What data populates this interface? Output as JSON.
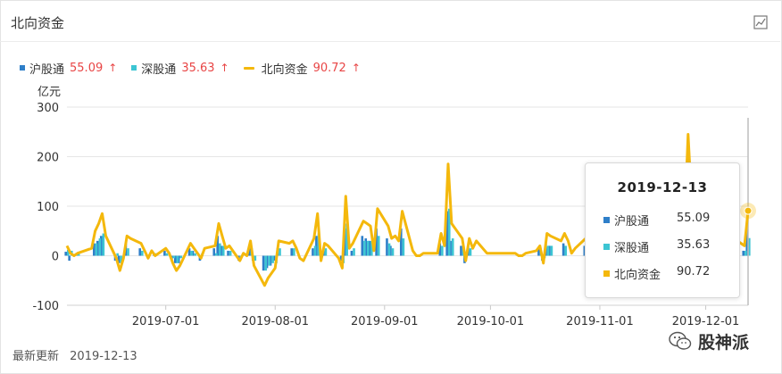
{
  "panel": {
    "title": "北向资金"
  },
  "legend": [
    {
      "name": "沪股通",
      "value": "55.09",
      "arrow": "↑",
      "color": "#2e7fc9"
    },
    {
      "name": "深股通",
      "value": "35.63",
      "arrow": "↑",
      "color": "#3cc5d3"
    },
    {
      "name": "北向资金",
      "value": "90.72",
      "arrow": "↑",
      "color": "#f4b80c"
    }
  ],
  "tooltip": {
    "date": "2019-12-13",
    "rows": [
      {
        "name": "沪股通",
        "value": "55.09"
      },
      {
        "name": "深股通",
        "value": "35.63"
      },
      {
        "name": "北向资金",
        "value": "90.72"
      }
    ]
  },
  "footer": {
    "label": "最新更新",
    "date": "2019-12-13"
  },
  "watermark": {
    "text": "股神派"
  },
  "colors": {
    "sh": "#2e7fc9",
    "sz": "#3cc5d3",
    "total": "#f4b80c",
    "grid": "#e6e6e6"
  },
  "chart_data": {
    "type": "bar+line",
    "ylabel": "亿元",
    "ylim": [
      -100,
      300
    ],
    "yticks": [
      -100,
      0,
      100,
      200,
      300
    ],
    "xticks": [
      "2019-07-01",
      "2019-08-01",
      "2019-09-01",
      "2019-10-01",
      "2019-11-01",
      "2019-12-01"
    ],
    "x_start": "2019-06-03",
    "x_end": "2019-12-13",
    "grid": "horizontal",
    "series": [
      {
        "name": "北向资金",
        "type": "line",
        "values": [
          [
            "2019-06-03",
            20
          ],
          [
            "2019-06-04",
            5
          ],
          [
            "2019-06-05",
            0
          ],
          [
            "2019-06-06",
            5
          ],
          [
            "2019-06-10",
            15
          ],
          [
            "2019-06-11",
            50
          ],
          [
            "2019-06-12",
            65
          ],
          [
            "2019-06-13",
            85
          ],
          [
            "2019-06-14",
            40
          ],
          [
            "2019-06-17",
            -5
          ],
          [
            "2019-06-18",
            -30
          ],
          [
            "2019-06-19",
            -5
          ],
          [
            "2019-06-20",
            40
          ],
          [
            "2019-06-21",
            35
          ],
          [
            "2019-06-24",
            25
          ],
          [
            "2019-06-25",
            10
          ],
          [
            "2019-06-26",
            -5
          ],
          [
            "2019-06-27",
            10
          ],
          [
            "2019-06-28",
            0
          ],
          [
            "2019-07-01",
            15
          ],
          [
            "2019-07-02",
            5
          ],
          [
            "2019-07-03",
            -15
          ],
          [
            "2019-07-04",
            -30
          ],
          [
            "2019-07-05",
            -20
          ],
          [
            "2019-07-08",
            25
          ],
          [
            "2019-07-09",
            15
          ],
          [
            "2019-07-10",
            5
          ],
          [
            "2019-07-11",
            -5
          ],
          [
            "2019-07-12",
            15
          ],
          [
            "2019-07-15",
            20
          ],
          [
            "2019-07-16",
            65
          ],
          [
            "2019-07-17",
            40
          ],
          [
            "2019-07-18",
            15
          ],
          [
            "2019-07-19",
            20
          ],
          [
            "2019-07-22",
            -10
          ],
          [
            "2019-07-23",
            5
          ],
          [
            "2019-07-24",
            0
          ],
          [
            "2019-07-25",
            30
          ],
          [
            "2019-07-26",
            -20
          ],
          [
            "2019-07-29",
            -60
          ],
          [
            "2019-07-30",
            -45
          ],
          [
            "2019-07-31",
            -35
          ],
          [
            "2019-08-01",
            -25
          ],
          [
            "2019-08-02",
            30
          ],
          [
            "2019-08-05",
            25
          ],
          [
            "2019-08-06",
            30
          ],
          [
            "2019-08-07",
            15
          ],
          [
            "2019-08-08",
            -5
          ],
          [
            "2019-08-09",
            -10
          ],
          [
            "2019-08-12",
            35
          ],
          [
            "2019-08-13",
            85
          ],
          [
            "2019-08-14",
            -10
          ],
          [
            "2019-08-15",
            25
          ],
          [
            "2019-08-16",
            20
          ],
          [
            "2019-08-19",
            -5
          ],
          [
            "2019-08-20",
            -25
          ],
          [
            "2019-08-21",
            120
          ],
          [
            "2019-08-22",
            15
          ],
          [
            "2019-08-23",
            25
          ],
          [
            "2019-08-26",
            70
          ],
          [
            "2019-08-27",
            65
          ],
          [
            "2019-08-28",
            60
          ],
          [
            "2019-08-29",
            10
          ],
          [
            "2019-08-30",
            95
          ],
          [
            "2019-09-02",
            60
          ],
          [
            "2019-09-03",
            35
          ],
          [
            "2019-09-04",
            40
          ],
          [
            "2019-09-05",
            30
          ],
          [
            "2019-09-06",
            90
          ],
          [
            "2019-09-09",
            10
          ],
          [
            "2019-09-10",
            0
          ],
          [
            "2019-09-11",
            0
          ],
          [
            "2019-09-12",
            5
          ],
          [
            "2019-09-16",
            5
          ],
          [
            "2019-09-17",
            45
          ],
          [
            "2019-09-18",
            20
          ],
          [
            "2019-09-19",
            185
          ],
          [
            "2019-09-20",
            65
          ],
          [
            "2019-09-23",
            35
          ],
          [
            "2019-09-24",
            -10
          ],
          [
            "2019-09-25",
            35
          ],
          [
            "2019-09-26",
            15
          ],
          [
            "2019-09-27",
            30
          ],
          [
            "2019-09-30",
            5
          ],
          [
            "2019-10-08",
            5
          ],
          [
            "2019-10-09",
            0
          ],
          [
            "2019-10-10",
            0
          ],
          [
            "2019-10-11",
            5
          ],
          [
            "2019-10-14",
            10
          ],
          [
            "2019-10-15",
            20
          ],
          [
            "2019-10-16",
            -15
          ],
          [
            "2019-10-17",
            45
          ],
          [
            "2019-10-18",
            40
          ],
          [
            "2019-10-21",
            30
          ],
          [
            "2019-10-22",
            45
          ],
          [
            "2019-10-23",
            30
          ],
          [
            "2019-10-24",
            5
          ],
          [
            "2019-10-25",
            15
          ],
          [
            "2019-10-28",
            35
          ],
          [
            "2019-10-29",
            5
          ],
          [
            "2019-10-30",
            -10
          ],
          [
            "2019-10-31",
            25
          ],
          [
            "2019-11-01",
            35
          ],
          [
            "2019-11-04",
            40
          ],
          [
            "2019-11-05",
            95
          ],
          [
            "2019-11-06",
            65
          ],
          [
            "2019-11-07",
            40
          ],
          [
            "2019-11-08",
            45
          ],
          [
            "2019-11-11",
            60
          ],
          [
            "2019-11-12",
            55
          ],
          [
            "2019-11-13",
            55
          ],
          [
            "2019-11-14",
            40
          ],
          [
            "2019-11-15",
            50
          ],
          [
            "2019-11-18",
            60
          ],
          [
            "2019-11-19",
            70
          ],
          [
            "2019-11-20",
            50
          ],
          [
            "2019-11-21",
            40
          ],
          [
            "2019-11-22",
            60
          ],
          [
            "2019-11-25",
            65
          ],
          [
            "2019-11-26",
            245
          ],
          [
            "2019-11-27",
            110
          ],
          [
            "2019-11-28",
            60
          ],
          [
            "2019-11-29",
            55
          ],
          [
            "2019-12-02",
            40
          ],
          [
            "2019-12-03",
            60
          ],
          [
            "2019-12-04",
            50
          ],
          [
            "2019-12-05",
            55
          ],
          [
            "2019-12-06",
            45
          ],
          [
            "2019-12-09",
            40
          ],
          [
            "2019-12-10",
            30
          ],
          [
            "2019-12-11",
            25
          ],
          [
            "2019-12-12",
            20
          ],
          [
            "2019-12-13",
            90.72
          ]
        ]
      },
      {
        "name": "沪股通",
        "type": "bar",
        "values": [
          [
            "2019-06-03",
            8
          ],
          [
            "2019-06-04",
            -10
          ],
          [
            "2019-06-06",
            5
          ],
          [
            "2019-06-11",
            25
          ],
          [
            "2019-06-12",
            30
          ],
          [
            "2019-06-13",
            40
          ],
          [
            "2019-06-17",
            -10
          ],
          [
            "2019-06-18",
            -15
          ],
          [
            "2019-06-20",
            25
          ],
          [
            "2019-06-24",
            15
          ],
          [
            "2019-06-28",
            5
          ],
          [
            "2019-07-01",
            10
          ],
          [
            "2019-07-03",
            -10
          ],
          [
            "2019-07-04",
            -15
          ],
          [
            "2019-07-05",
            -15
          ],
          [
            "2019-07-08",
            15
          ],
          [
            "2019-07-09",
            10
          ],
          [
            "2019-07-11",
            -10
          ],
          [
            "2019-07-15",
            15
          ],
          [
            "2019-07-16",
            40
          ],
          [
            "2019-07-17",
            20
          ],
          [
            "2019-07-19",
            10
          ],
          [
            "2019-07-22",
            -10
          ],
          [
            "2019-07-25",
            15
          ],
          [
            "2019-07-26",
            -10
          ],
          [
            "2019-07-29",
            -30
          ],
          [
            "2019-07-30",
            -25
          ],
          [
            "2019-07-31",
            -20
          ],
          [
            "2019-08-01",
            -10
          ],
          [
            "2019-08-02",
            15
          ],
          [
            "2019-08-06",
            15
          ],
          [
            "2019-08-12",
            15
          ],
          [
            "2019-08-13",
            40
          ],
          [
            "2019-08-15",
            10
          ],
          [
            "2019-08-20",
            -10
          ],
          [
            "2019-08-21",
            55
          ],
          [
            "2019-08-23",
            10
          ],
          [
            "2019-08-26",
            40
          ],
          [
            "2019-08-27",
            35
          ],
          [
            "2019-08-28",
            30
          ],
          [
            "2019-08-30",
            55
          ],
          [
            "2019-09-02",
            35
          ],
          [
            "2019-09-03",
            20
          ],
          [
            "2019-09-06",
            55
          ],
          [
            "2019-09-17",
            25
          ],
          [
            "2019-09-19",
            90
          ],
          [
            "2019-09-20",
            30
          ],
          [
            "2019-09-23",
            20
          ],
          [
            "2019-09-24",
            -15
          ],
          [
            "2019-09-25",
            20
          ],
          [
            "2019-10-15",
            15
          ],
          [
            "2019-10-16",
            -10
          ],
          [
            "2019-10-17",
            25
          ],
          [
            "2019-10-18",
            20
          ],
          [
            "2019-10-22",
            25
          ],
          [
            "2019-10-28",
            20
          ],
          [
            "2019-10-30",
            -10
          ],
          [
            "2019-10-31",
            15
          ],
          [
            "2019-11-04",
            20
          ],
          [
            "2019-11-05",
            50
          ],
          [
            "2019-12-12",
            10
          ],
          [
            "2019-12-13",
            55.09
          ]
        ]
      },
      {
        "name": "深股通",
        "type": "bar",
        "values": [
          [
            "2019-06-03",
            12
          ],
          [
            "2019-06-04",
            10
          ],
          [
            "2019-06-06",
            5
          ],
          [
            "2019-06-11",
            25
          ],
          [
            "2019-06-12",
            35
          ],
          [
            "2019-06-13",
            45
          ],
          [
            "2019-06-17",
            5
          ],
          [
            "2019-06-18",
            -15
          ],
          [
            "2019-06-20",
            15
          ],
          [
            "2019-06-24",
            10
          ],
          [
            "2019-06-28",
            5
          ],
          [
            "2019-07-01",
            5
          ],
          [
            "2019-07-03",
            -5
          ],
          [
            "2019-07-04",
            -15
          ],
          [
            "2019-07-05",
            -5
          ],
          [
            "2019-07-08",
            10
          ],
          [
            "2019-07-09",
            5
          ],
          [
            "2019-07-11",
            5
          ],
          [
            "2019-07-15",
            5
          ],
          [
            "2019-07-16",
            25
          ],
          [
            "2019-07-17",
            20
          ],
          [
            "2019-07-19",
            10
          ],
          [
            "2019-07-22",
            0
          ],
          [
            "2019-07-25",
            15
          ],
          [
            "2019-07-26",
            -10
          ],
          [
            "2019-07-29",
            -30
          ],
          [
            "2019-07-30",
            -20
          ],
          [
            "2019-07-31",
            -15
          ],
          [
            "2019-08-01",
            -15
          ],
          [
            "2019-08-02",
            15
          ],
          [
            "2019-08-06",
            15
          ],
          [
            "2019-08-12",
            20
          ],
          [
            "2019-08-13",
            45
          ],
          [
            "2019-08-15",
            15
          ],
          [
            "2019-08-20",
            -15
          ],
          [
            "2019-08-21",
            65
          ],
          [
            "2019-08-23",
            15
          ],
          [
            "2019-08-26",
            30
          ],
          [
            "2019-08-27",
            30
          ],
          [
            "2019-08-28",
            30
          ],
          [
            "2019-08-30",
            40
          ],
          [
            "2019-09-02",
            25
          ],
          [
            "2019-09-03",
            15
          ],
          [
            "2019-09-06",
            35
          ],
          [
            "2019-09-17",
            20
          ],
          [
            "2019-09-19",
            95
          ],
          [
            "2019-09-20",
            35
          ],
          [
            "2019-09-23",
            15
          ],
          [
            "2019-09-24",
            5
          ],
          [
            "2019-09-25",
            15
          ],
          [
            "2019-10-15",
            5
          ],
          [
            "2019-10-16",
            -5
          ],
          [
            "2019-10-17",
            20
          ],
          [
            "2019-10-18",
            20
          ],
          [
            "2019-10-22",
            20
          ],
          [
            "2019-10-28",
            15
          ],
          [
            "2019-10-30",
            0
          ],
          [
            "2019-10-31",
            10
          ],
          [
            "2019-11-04",
            20
          ],
          [
            "2019-11-05",
            45
          ],
          [
            "2019-12-12",
            10
          ],
          [
            "2019-12-13",
            35.63
          ]
        ]
      }
    ]
  }
}
